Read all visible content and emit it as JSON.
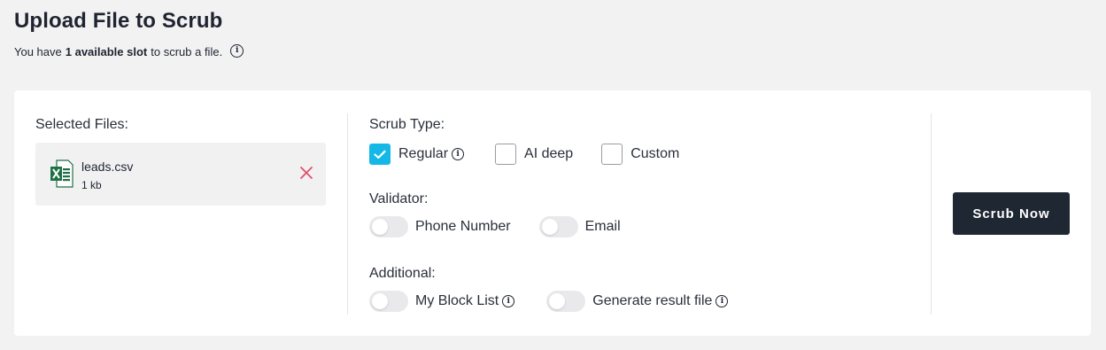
{
  "header": {
    "title": "Upload File to Scrub",
    "subtitle_prefix": "You have",
    "subtitle_bold": "1 available slot",
    "subtitle_suffix": "to scrub a file."
  },
  "files": {
    "label": "Selected Files:",
    "items": [
      {
        "name": "leads.csv",
        "size": "1 kb",
        "icon": "excel-file-icon"
      }
    ]
  },
  "scrub_type": {
    "label": "Scrub Type:",
    "options": [
      {
        "label": "Regular",
        "checked": true,
        "info": true
      },
      {
        "label": "AI deep",
        "checked": false,
        "info": false
      },
      {
        "label": "Custom",
        "checked": false,
        "info": false
      }
    ]
  },
  "validator": {
    "label": "Validator:",
    "options": [
      {
        "label": "Phone Number",
        "on": false
      },
      {
        "label": "Email",
        "on": false
      }
    ]
  },
  "additional": {
    "label": "Additional:",
    "options": [
      {
        "label": "My Block List",
        "on": false,
        "info": true
      },
      {
        "label": "Generate result file",
        "on": false,
        "info": true
      }
    ]
  },
  "action": {
    "label": "Scrub Now"
  },
  "colors": {
    "accent": "#14b8e6",
    "button_bg": "#1f2733",
    "remove": "#e0506a",
    "excel_green": "#1e7145"
  }
}
